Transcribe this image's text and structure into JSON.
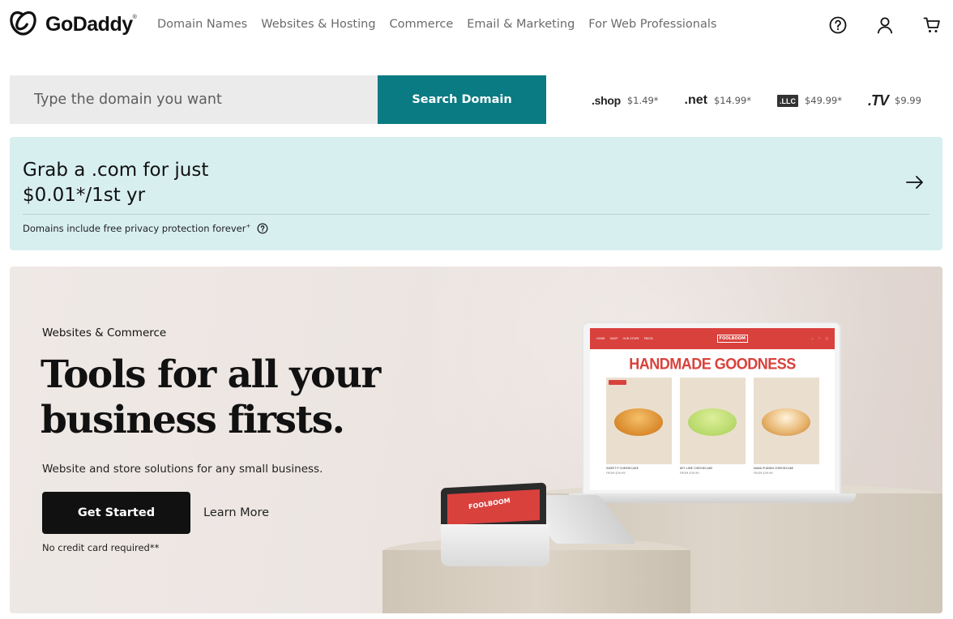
{
  "header": {
    "logo_text": "GoDaddy",
    "nav": [
      "Domain Names",
      "Websites & Hosting",
      "Commerce",
      "Email & Marketing",
      "For Web Professionals"
    ],
    "icons": [
      "help-icon",
      "account-icon",
      "cart-icon"
    ]
  },
  "search": {
    "placeholder": "Type the domain you want",
    "button_label": "Search Domain"
  },
  "tlds": [
    {
      "logo": ".shop",
      "price": "$1.49*"
    },
    {
      "logo": ".net",
      "price": "$14.99*"
    },
    {
      "logo": ".LLC",
      "price": "$49.99*"
    },
    {
      "logo": ".TV",
      "price": "$9.99"
    }
  ],
  "promo": {
    "title": "Grab a .com for just\n$0.01*/1st yr",
    "note": "Domains include free privacy protection forever",
    "note_mark": "+"
  },
  "hero": {
    "eyebrow": "Websites & Commerce",
    "title": "Tools for all your\nbusiness firsts.",
    "subtitle": "Website and store solutions for any small business.",
    "cta_label": "Get Started",
    "secondary_label": "Learn More",
    "fine_print": "No credit card required**"
  },
  "mockup": {
    "headline": "HANDMADE GOODNESS",
    "nav": [
      "HOME",
      "SHOP",
      "OUR STORY",
      "PRESS"
    ],
    "logo": "FOOLBOOM",
    "products": [
      {
        "name": "SWEET P CHEESECAKE",
        "price": "FROM $39.99"
      },
      {
        "name": "KEY LIME CHEESECAKE",
        "price": "FROM $39.99"
      },
      {
        "name": "NANA PUDDIN CHEESECAKE",
        "price": "FROM $39.99"
      }
    ]
  },
  "colors": {
    "brand_teal": "#0a7b83",
    "promo_bg": "#d8eff0",
    "cta_bg": "#111111",
    "mockup_red": "#d9413d"
  }
}
